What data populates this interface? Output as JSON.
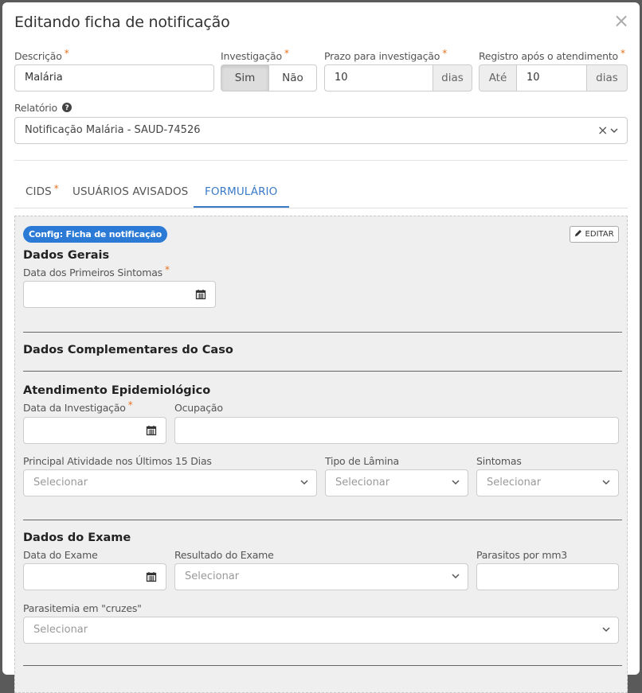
{
  "modal": {
    "title": "Editando ficha de notificação",
    "close_symbol": "×"
  },
  "fields": {
    "descricao": {
      "label": "Descrição",
      "value": "Malária",
      "required": "*"
    },
    "investigacao": {
      "label": "Investigação",
      "required": "*",
      "options": [
        "Sim",
        "Não"
      ],
      "selected": "Sim"
    },
    "prazo": {
      "label": "Prazo para investigação",
      "required": "*",
      "value": "10",
      "unit": "dias"
    },
    "registro": {
      "label": "Registro após o atendimento",
      "required": "*",
      "prefix": "Até",
      "value": "10",
      "unit": "dias"
    },
    "relatorio": {
      "label": "Relatório",
      "value": "Notificação Malária - SAUD-74526",
      "clear_symbol": "×"
    }
  },
  "tabs": [
    {
      "label": "CIDS",
      "required": "*",
      "active": false
    },
    {
      "label": "USUÁRIOS AVISADOS",
      "active": false
    },
    {
      "label": "FORMULÁRIO",
      "active": true
    }
  ],
  "form": {
    "badge": "Config: Ficha de notificação",
    "edit_label": "EDITAR",
    "sections": {
      "dados_gerais": {
        "title": "Dados Gerais",
        "data_primeiros_sintomas": {
          "label": "Data dos Primeiros Sintomas",
          "required": "*"
        }
      },
      "complementares": {
        "title": "Dados Complementares do Caso"
      },
      "atendimento": {
        "title": "Atendimento Epidemiológico",
        "data_investigacao": {
          "label": "Data da Investigação",
          "required": "*"
        },
        "ocupacao": {
          "label": "Ocupação"
        },
        "principal_atividade": {
          "label": "Principal Atividade nos Últimos 15 Dias",
          "placeholder": "Selecionar"
        },
        "tipo_lamina": {
          "label": "Tipo de Lâmina",
          "placeholder": "Selecionar"
        },
        "sintomas": {
          "label": "Sintomas",
          "placeholder": "Selecionar"
        }
      },
      "exame": {
        "title": "Dados do Exame",
        "data_exame": {
          "label": "Data do Exame"
        },
        "resultado": {
          "label": "Resultado do Exame",
          "placeholder": "Selecionar"
        },
        "parasitos": {
          "label": "Parasitos por mm3"
        },
        "parasitemia": {
          "label": "Parasitemia em \"cruzes\"",
          "placeholder": "Selecionar"
        }
      }
    }
  },
  "colors": {
    "accent": "#3a7bc8",
    "badge": "#2b7bd6",
    "required": "#e8731f"
  },
  "icons": [
    "close-icon",
    "question-circle-icon",
    "chevron-down-icon",
    "calendar-icon",
    "pencil-icon"
  ]
}
